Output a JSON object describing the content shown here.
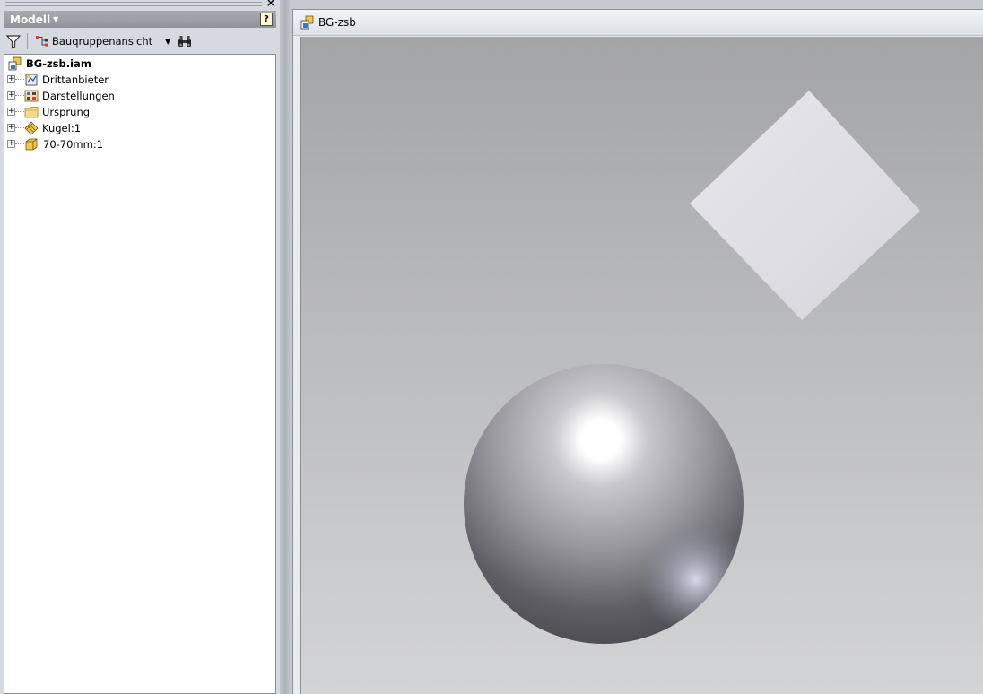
{
  "panel": {
    "title": "Modell",
    "close_glyph": "×",
    "help_glyph": "?"
  },
  "toolbar": {
    "filter_icon": "filter-icon",
    "view_label": "Bauqruppenansicht",
    "search_icon": "binoculars-icon"
  },
  "tree": {
    "root": {
      "label": "BG-zsb.iam",
      "icon": "assembly-icon"
    },
    "items": [
      {
        "label": "Drittanbieter",
        "icon": "third-party-icon",
        "expander": "+"
      },
      {
        "label": "Darstellungen",
        "icon": "representations-icon",
        "expander": "+"
      },
      {
        "label": "Ursprung",
        "icon": "folder-icon",
        "expander": "+"
      },
      {
        "label": "Kugel:1",
        "icon": "sphere-part-icon",
        "expander": "+"
      },
      {
        "label": "70-70mm:1",
        "icon": "part-icon",
        "expander": "+"
      }
    ]
  },
  "document": {
    "tab_label": "BG-zsb",
    "tab_icon": "assembly-icon"
  },
  "colors": {
    "panel_header": "#979ca3",
    "viewport_top": "#a3a4a6",
    "viewport_bottom": "#d3d4d6",
    "square_face": "#dcdce0"
  }
}
